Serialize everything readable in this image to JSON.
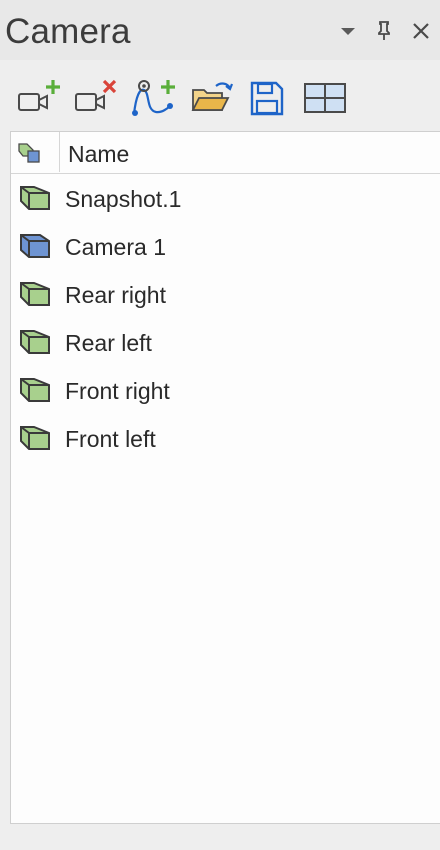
{
  "window": {
    "title": "Camera",
    "controls": [
      {
        "name": "dropdown-arrow-icon"
      },
      {
        "name": "pin-icon"
      },
      {
        "name": "close-icon"
      }
    ]
  },
  "toolbar": {
    "tools": [
      {
        "name": "add-camera-icon"
      },
      {
        "name": "remove-camera-icon"
      },
      {
        "name": "add-camera-path-icon"
      },
      {
        "name": "open-folder-icon"
      },
      {
        "name": "save-icon"
      },
      {
        "name": "split-view-icon"
      }
    ]
  },
  "list": {
    "header_name": "Name",
    "items": [
      {
        "label": "Snapshot.1",
        "icon": "green-camera-icon",
        "color": "#a8d08d"
      },
      {
        "label": "Camera 1",
        "icon": "blue-camera-icon",
        "color": "#6e94d2"
      },
      {
        "label": "Rear right",
        "icon": "green-camera-icon",
        "color": "#a8d08d"
      },
      {
        "label": "Rear left",
        "icon": "green-camera-icon",
        "color": "#a8d08d"
      },
      {
        "label": "Front right",
        "icon": "green-camera-icon",
        "color": "#a8d08d"
      },
      {
        "label": "Front left",
        "icon": "green-camera-icon",
        "color": "#a8d08d"
      }
    ]
  },
  "colors": {
    "accent_blue": "#1e64c8",
    "green_plus": "#5aae3a",
    "red_x": "#d9443a",
    "folder": "#e9b64a"
  }
}
